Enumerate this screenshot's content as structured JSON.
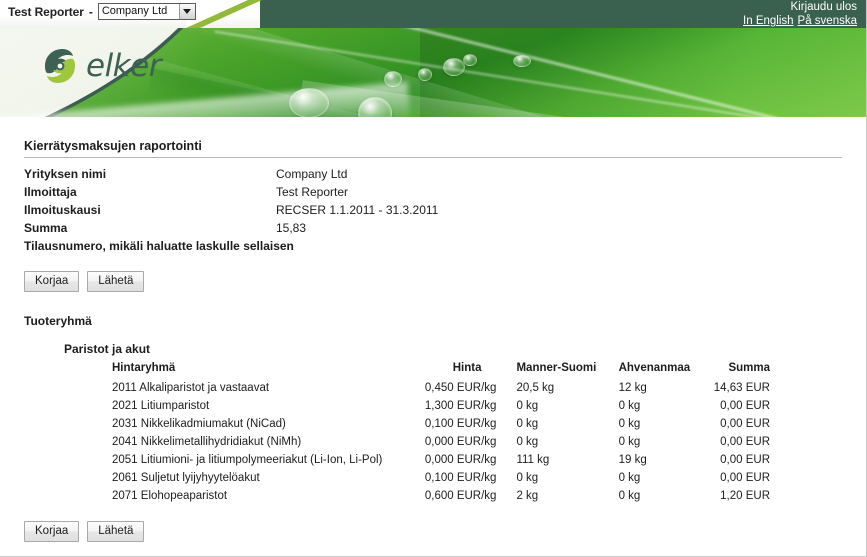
{
  "topbar": {
    "reporter_label": "Test Reporter",
    "dash": "-",
    "company_selected": "Company Ltd",
    "logout_label": "Kirjaudu ulos",
    "lang_en": "In English",
    "lang_sv": "På svenska"
  },
  "branding": {
    "wordmark": "elker"
  },
  "page": {
    "title": "Kierrätysmaksujen raportointi"
  },
  "info": {
    "rows": [
      {
        "label": "Yrityksen nimi",
        "value": "Company Ltd"
      },
      {
        "label": "Ilmoittaja",
        "value": "Test Reporter"
      },
      {
        "label": "Ilmoituskausi",
        "value": "RECSER 1.1.2011 - 31.3.2011"
      },
      {
        "label": "Summa",
        "value": "15,83"
      },
      {
        "label": "Tilausnumero, mikäli haluatte laskulle sellaisen",
        "value": ""
      }
    ]
  },
  "buttons": {
    "correct": "Korjaa",
    "send": "Lähetä"
  },
  "sections": {
    "product_group_heading": "Tuoteryhmä",
    "subgroup_heading": "Paristot ja akut"
  },
  "table": {
    "headers": {
      "name": "Hintaryhmä",
      "price": "Hinta",
      "mainland": "Manner-Suomi",
      "aland": "Ahvenanmaa",
      "sum": "Summa"
    },
    "rows": [
      {
        "name": "2011 Alkaliparistot ja vastaavat",
        "price": "0,450 EUR/kg",
        "mainland": "20,5 kg",
        "aland": "12 kg",
        "sum": "14,63 EUR"
      },
      {
        "name": "2021 Litiumparistot",
        "price": "1,300 EUR/kg",
        "mainland": "0 kg",
        "aland": "0 kg",
        "sum": "0,00 EUR"
      },
      {
        "name": "2031 Nikkelikadmiumakut (NiCad)",
        "price": "0,100 EUR/kg",
        "mainland": "0 kg",
        "aland": "0 kg",
        "sum": "0,00 EUR"
      },
      {
        "name": "2041 Nikkelimetallihydridiakut (NiMh)",
        "price": "0,000 EUR/kg",
        "mainland": "0 kg",
        "aland": "0 kg",
        "sum": "0,00 EUR"
      },
      {
        "name": "2051 Litiumioni- ja litiumpolymeeriakut (Li-Ion, Li-Pol)",
        "price": "0,000 EUR/kg",
        "mainland": "111 kg",
        "aland": "19 kg",
        "sum": "0,00 EUR"
      },
      {
        "name": "2061 Suljetut lyijyhyytelöakut",
        "price": "0,100 EUR/kg",
        "mainland": "0 kg",
        "aland": "0 kg",
        "sum": "0,00 EUR"
      },
      {
        "name": "2071 Elohopeaparistot",
        "price": "0,600 EUR/kg",
        "mainland": "2 kg",
        "aland": "0 kg",
        "sum": "1,20 EUR"
      }
    ]
  },
  "colors": {
    "dark_green": "#3a6050",
    "lime": "#92b93a",
    "leaf_green": "#4aa32a",
    "logo_green": "#3d6152"
  }
}
